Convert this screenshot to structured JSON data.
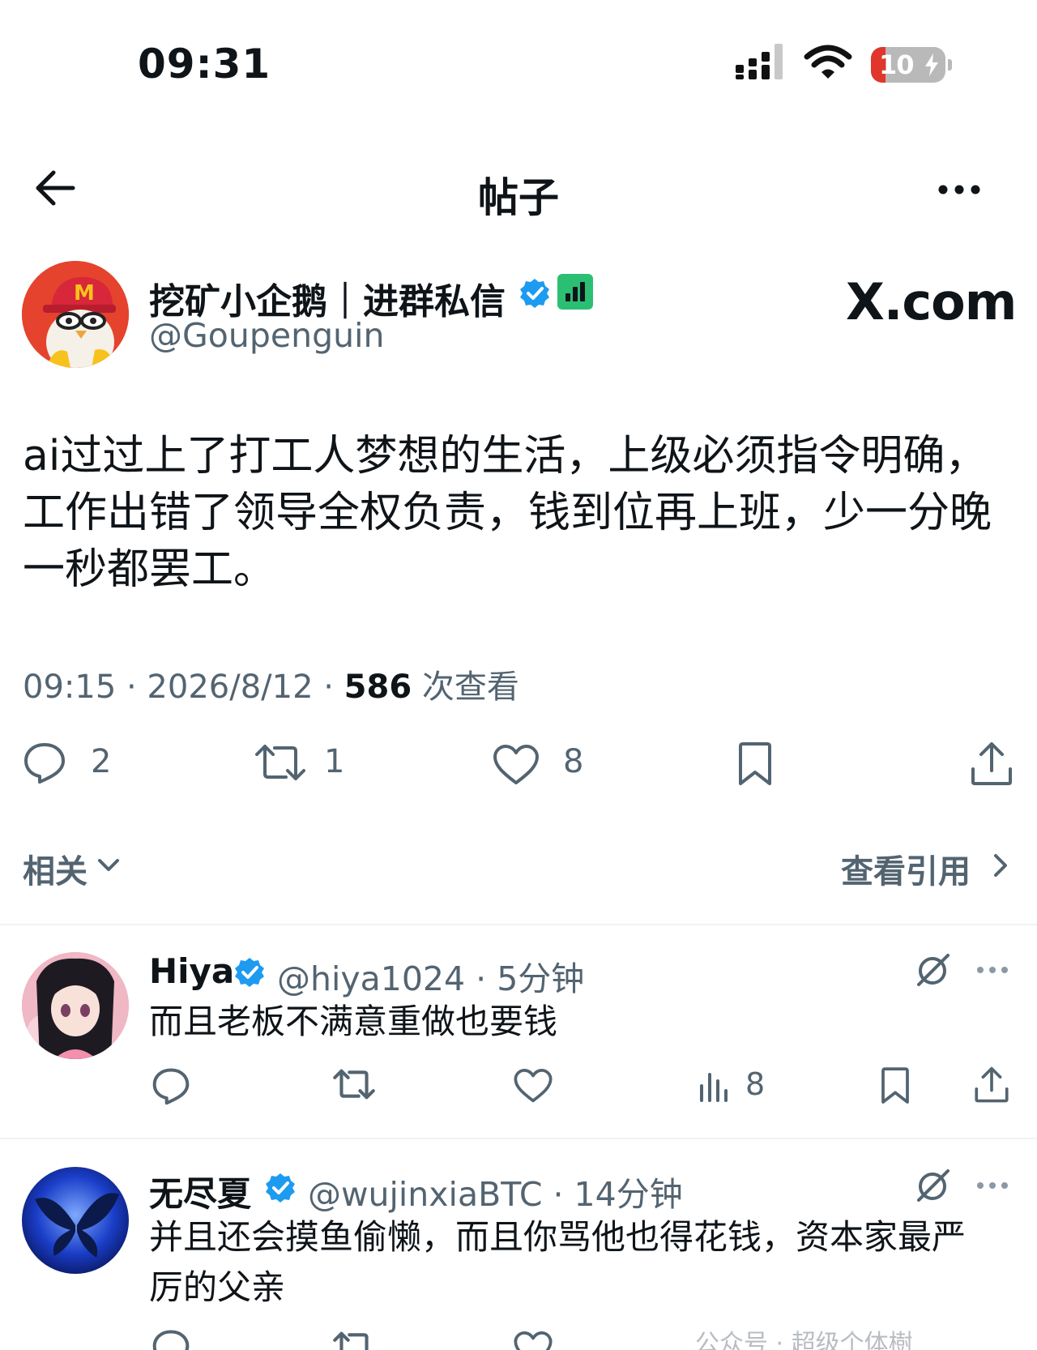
{
  "status_bar": {
    "time": "09:31",
    "battery": "10"
  },
  "header": {
    "title": "帖子"
  },
  "post": {
    "author_name": "挖矿小企鹅｜进群私信",
    "handle": "@Goupenguin",
    "brand": "X.com",
    "text": "ai过过上了打工人梦想的生活，上级必须指令明确，工作出错了领导全权负责，钱到位再上班，少一分晚一秒都罢工。",
    "meta": {
      "time_date": "09:15 · 2026/8/12 · ",
      "views": "586",
      "views_label": " 次查看"
    },
    "actions": {
      "replies": "2",
      "reposts": "1",
      "likes": "8"
    },
    "related_label": "相关",
    "quotes_label": "查看引用"
  },
  "replies": [
    {
      "name": "Hiya",
      "handle_time": "@hiya1024 · 5分钟",
      "text": "而且老板不满意重做也要钱",
      "views": "8"
    },
    {
      "name": "无尽夏",
      "handle_time": "@wujinxiaBTC · 14分钟",
      "text": "并且还会摸鱼偷懒，而且你骂他也得花钱，资本家最严厉的父亲"
    }
  ],
  "watermark": "公众号 · 超级个体樹",
  "colors": {
    "verified": "#1d9bf0",
    "text": "#0f1419",
    "muted": "#536471",
    "green_badge": "#2bbf74"
  }
}
